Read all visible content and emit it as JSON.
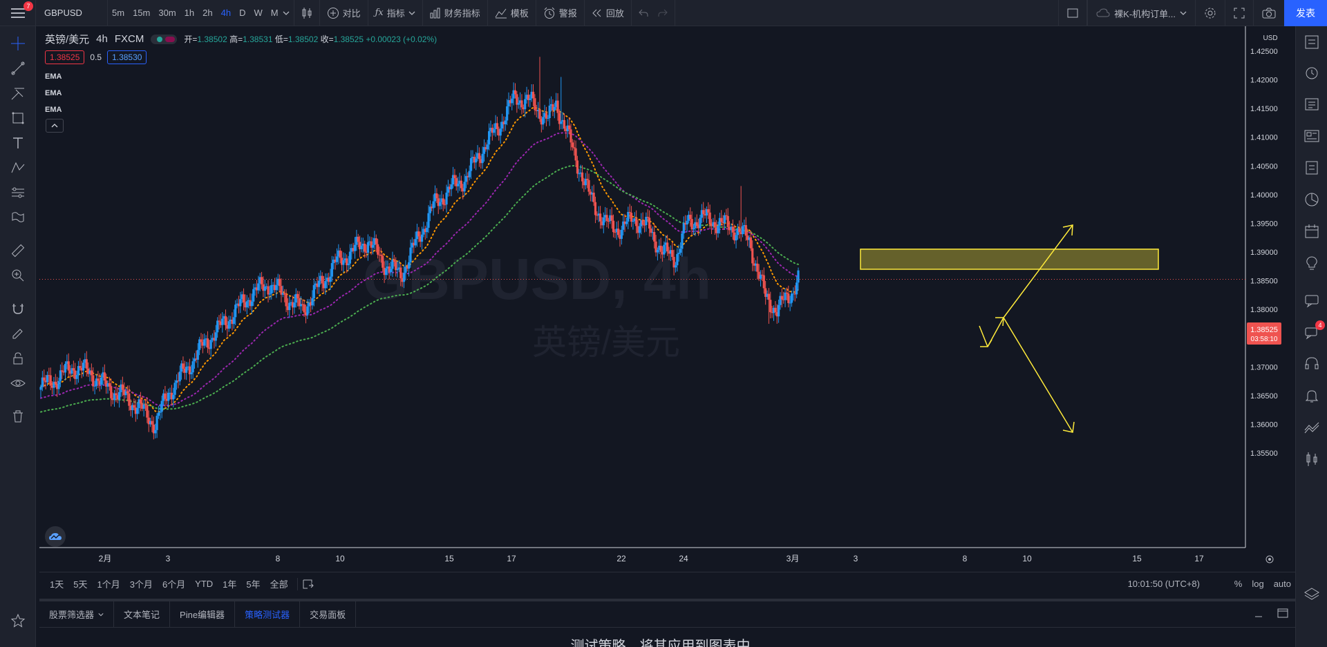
{
  "topbar": {
    "menu_badge": "7",
    "symbol": "GBPUSD",
    "intervals": [
      {
        "label": "5m",
        "active": false
      },
      {
        "label": "15m",
        "active": false
      },
      {
        "label": "30m",
        "active": false
      },
      {
        "label": "1h",
        "active": false
      },
      {
        "label": "2h",
        "active": false
      },
      {
        "label": "4h",
        "active": true
      },
      {
        "label": "D",
        "active": false
      },
      {
        "label": "W",
        "active": false
      },
      {
        "label": "M",
        "active": false
      }
    ],
    "compare_label": "对比",
    "indicators_label": "指标",
    "financials_label": "财务指标",
    "templates_label": "模板",
    "alert_label": "警报",
    "replay_label": "回放",
    "layout_name": "裸K-机构订单...",
    "publish_label": "发表"
  },
  "legend": {
    "title": "英镑/美元",
    "interval": "4h",
    "exchange": "FXCM",
    "open_label": "开=",
    "open": "1.38502",
    "high_label": "高=",
    "high": "1.38531",
    "low_label": "低=",
    "low": "1.38502",
    "close_label": "收=",
    "close": "1.38525",
    "change": "+0.00023 (+0.02%)",
    "bid": "1.38525",
    "spread": "0.5",
    "ask": "1.38530",
    "ema_labels": [
      "EMA",
      "EMA",
      "EMA"
    ]
  },
  "chart_data": {
    "type": "candlestick",
    "watermark_symbol": "GBPUSD, 4h",
    "watermark_name": "英镑/美元",
    "currency": "USD",
    "y_ticks": [
      "1.42500",
      "1.42000",
      "1.41500",
      "1.41000",
      "1.40500",
      "1.40000",
      "1.39500",
      "1.39000",
      "1.38500",
      "1.38000",
      "1.37500",
      "1.37000",
      "1.36500",
      "1.36000",
      "1.35500"
    ],
    "ylim": [
      1.3525,
      1.4275
    ],
    "x_ticks": [
      "2月",
      "3",
      "8",
      "10",
      "15",
      "17",
      "22",
      "24",
      "3月",
      "3",
      "8",
      "10",
      "15",
      "17"
    ],
    "current_price": "1.38525",
    "countdown": "03:58:10",
    "ema_colors": [
      "#ff9800",
      "#9c27b0",
      "#4caf50"
    ],
    "zone": {
      "top": 1.3905,
      "bottom": 1.387,
      "color": "#ffeb3b"
    },
    "grid": false
  },
  "rangebar": {
    "ranges": [
      "1天",
      "5天",
      "1个月",
      "3个月",
      "6个月",
      "YTD",
      "1年",
      "5年",
      "全部"
    ],
    "time": "10:01:50 (UTC+8)",
    "percent": "%",
    "log": "log",
    "auto": "auto"
  },
  "bottom": {
    "tabs": [
      {
        "label": "股票筛选器",
        "active": false
      },
      {
        "label": "文本笔记",
        "active": false
      },
      {
        "label": "Pine编辑器",
        "active": false
      },
      {
        "label": "策略测试器",
        "active": true
      },
      {
        "label": "交易面板",
        "active": false
      }
    ],
    "message": "测试策略，将其应用到图表中。"
  },
  "righttools": {
    "chat_badge": "4"
  },
  "colors": {
    "up": "#2196f3",
    "down": "#ef5350",
    "accent": "#2962ff",
    "background": "#131722"
  }
}
